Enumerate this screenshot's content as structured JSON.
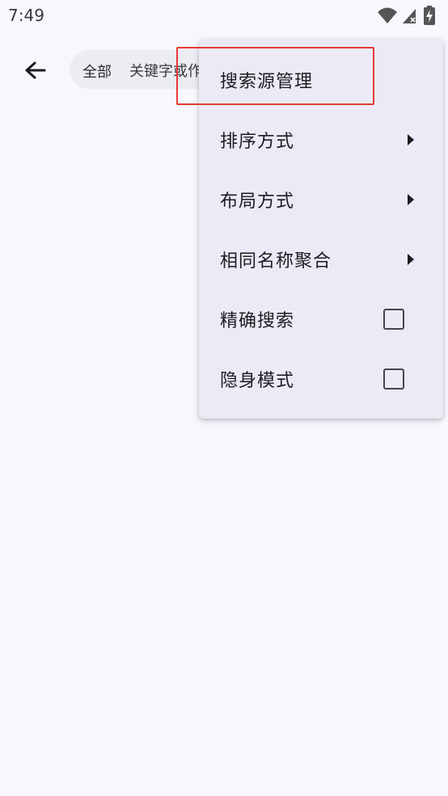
{
  "status_bar": {
    "time": "7:49",
    "icons": [
      "wifi-icon",
      "signal-icon",
      "battery-charging-icon"
    ]
  },
  "toolbar": {
    "back_icon": "arrow-left-icon",
    "search": {
      "scope": "全部",
      "value": "关键字或作者"
    }
  },
  "menu": {
    "items": [
      {
        "label": "搜索源管理",
        "kind": "action"
      },
      {
        "label": "排序方式",
        "kind": "submenu"
      },
      {
        "label": "布局方式",
        "kind": "submenu"
      },
      {
        "label": "相同名称聚合",
        "kind": "submenu"
      },
      {
        "label": "精确搜索",
        "kind": "checkbox",
        "checked": false
      },
      {
        "label": "隐身模式",
        "kind": "checkbox",
        "checked": false
      }
    ]
  },
  "colors": {
    "background": "#f8f7fd",
    "menu_background": "#ebeaf6",
    "highlight": "#e53935"
  }
}
